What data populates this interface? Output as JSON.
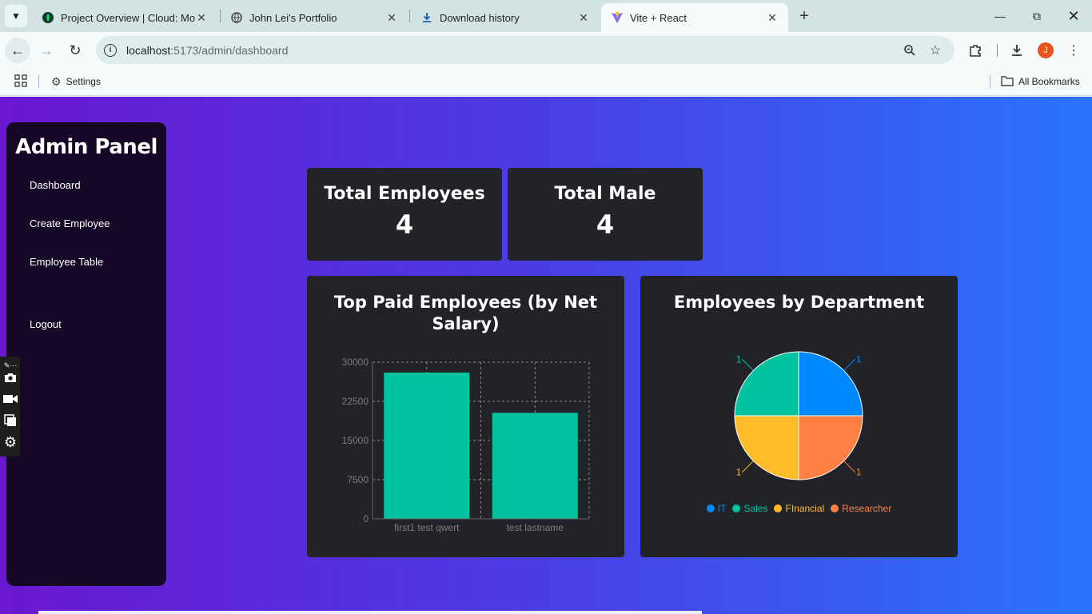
{
  "browser": {
    "tabs": [
      {
        "title": "Project Overview | Cloud: Mong",
        "favicon": "mongodb-leaf-icon",
        "active": false
      },
      {
        "title": "John Lei's Portfolio",
        "favicon": "globe-icon",
        "active": false
      },
      {
        "title": "Download history",
        "favicon": "download-icon",
        "active": false
      },
      {
        "title": "Vite + React",
        "favicon": "vite-icon",
        "active": true
      }
    ],
    "url": {
      "host": "localhost",
      "rest": ":5173/admin/dashboard"
    },
    "profile_initial": "J",
    "bookmarks": {
      "settings": "Settings",
      "all": "All Bookmarks"
    }
  },
  "sidebar": {
    "title": "Admin Panel",
    "links": [
      "Dashboard",
      "Create Employee",
      "Employee Table",
      "Logout"
    ]
  },
  "stats": [
    {
      "title": "Total Employees",
      "value": "4"
    },
    {
      "title": "Total Male",
      "value": "4"
    }
  ],
  "colors": {
    "bar": "#00c49f",
    "it": "#0088fe",
    "sales": "#00c49f",
    "financial": "#ffbb28",
    "researcher": "#ff8042",
    "card": "#212329"
  },
  "chart_data": [
    {
      "type": "bar",
      "title": "Top Paid Employees (by Net Salary)",
      "categories": [
        "first1 test qwert",
        "test lastname"
      ],
      "values": [
        28000,
        20300
      ],
      "ylim": [
        0,
        30000
      ],
      "yticks": [
        "0",
        "7500",
        "15000",
        "22500",
        "30000"
      ],
      "grid": true,
      "legend": "none"
    },
    {
      "type": "pie",
      "title": "Employees by Department",
      "categories": [
        "IT",
        "Sales",
        "FInancial",
        "Researcher"
      ],
      "values": [
        1,
        1,
        1,
        1
      ],
      "labels": [
        "1",
        "1",
        "1",
        "1"
      ],
      "legend": "bottom"
    }
  ]
}
